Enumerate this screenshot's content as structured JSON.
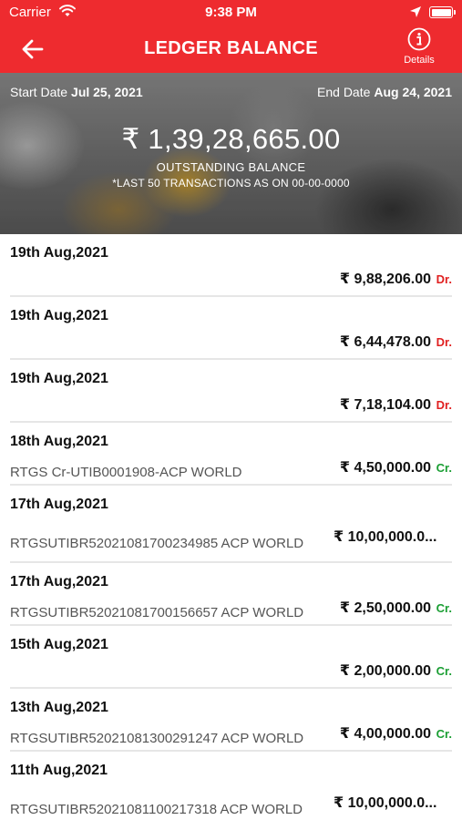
{
  "status_bar": {
    "carrier": "Carrier",
    "time": "9:38 PM"
  },
  "nav": {
    "title": "LEDGER BALANCE",
    "details_label": "Details"
  },
  "summary": {
    "start_label": "Start Date",
    "start_date": "Jul 25, 2021",
    "end_label": "End Date",
    "end_date": "Aug 24, 2021",
    "amount": "₹ 1,39,28,665.00",
    "balance_label": "OUTSTANDING BALANCE",
    "note": "*LAST 50 TRANSACTIONS AS ON 00-00-0000"
  },
  "transactions": [
    {
      "date": "19th Aug,2021",
      "description": "",
      "amount": "₹ 9,88,206.00",
      "type": "Dr."
    },
    {
      "date": "19th Aug,2021",
      "description": "",
      "amount": "₹ 6,44,478.00",
      "type": "Dr."
    },
    {
      "date": "19th Aug,2021",
      "description": "",
      "amount": "₹ 7,18,104.00",
      "type": "Dr."
    },
    {
      "date": "18th Aug,2021",
      "description": "RTGS Cr-UTIB0001908-ACP WORLD",
      "amount": "₹ 4,50,000.00",
      "type": "Cr."
    },
    {
      "date": "17th Aug,2021",
      "description": "RTGSUTIBR52021081700234985 ACP WORLD",
      "amount": "₹ 10,00,000.0...",
      "type": ""
    },
    {
      "date": "17th Aug,2021",
      "description": "RTGSUTIBR52021081700156657 ACP WORLD",
      "amount": "₹ 2,50,000.00",
      "type": "Cr."
    },
    {
      "date": "15th Aug,2021",
      "description": "",
      "amount": "₹ 2,00,000.00",
      "type": "Cr."
    },
    {
      "date": "13th Aug,2021",
      "description": "RTGSUTIBR52021081300291247 ACP WORLD",
      "amount": "₹ 4,00,000.00",
      "type": "Cr."
    },
    {
      "date": "11th Aug,2021",
      "description": "RTGSUTIBR52021081100217318 ACP WORLD",
      "amount": "₹ 10,00,000.0...",
      "type": ""
    }
  ],
  "colors": {
    "brand_red": "#ee2b2f",
    "debit": "#e02020",
    "credit": "#1a9e33"
  },
  "icons": {
    "back": "arrow-left-icon",
    "details": "info-circle-icon",
    "wifi": "wifi-icon",
    "location": "location-arrow-icon",
    "battery": "battery-icon"
  }
}
